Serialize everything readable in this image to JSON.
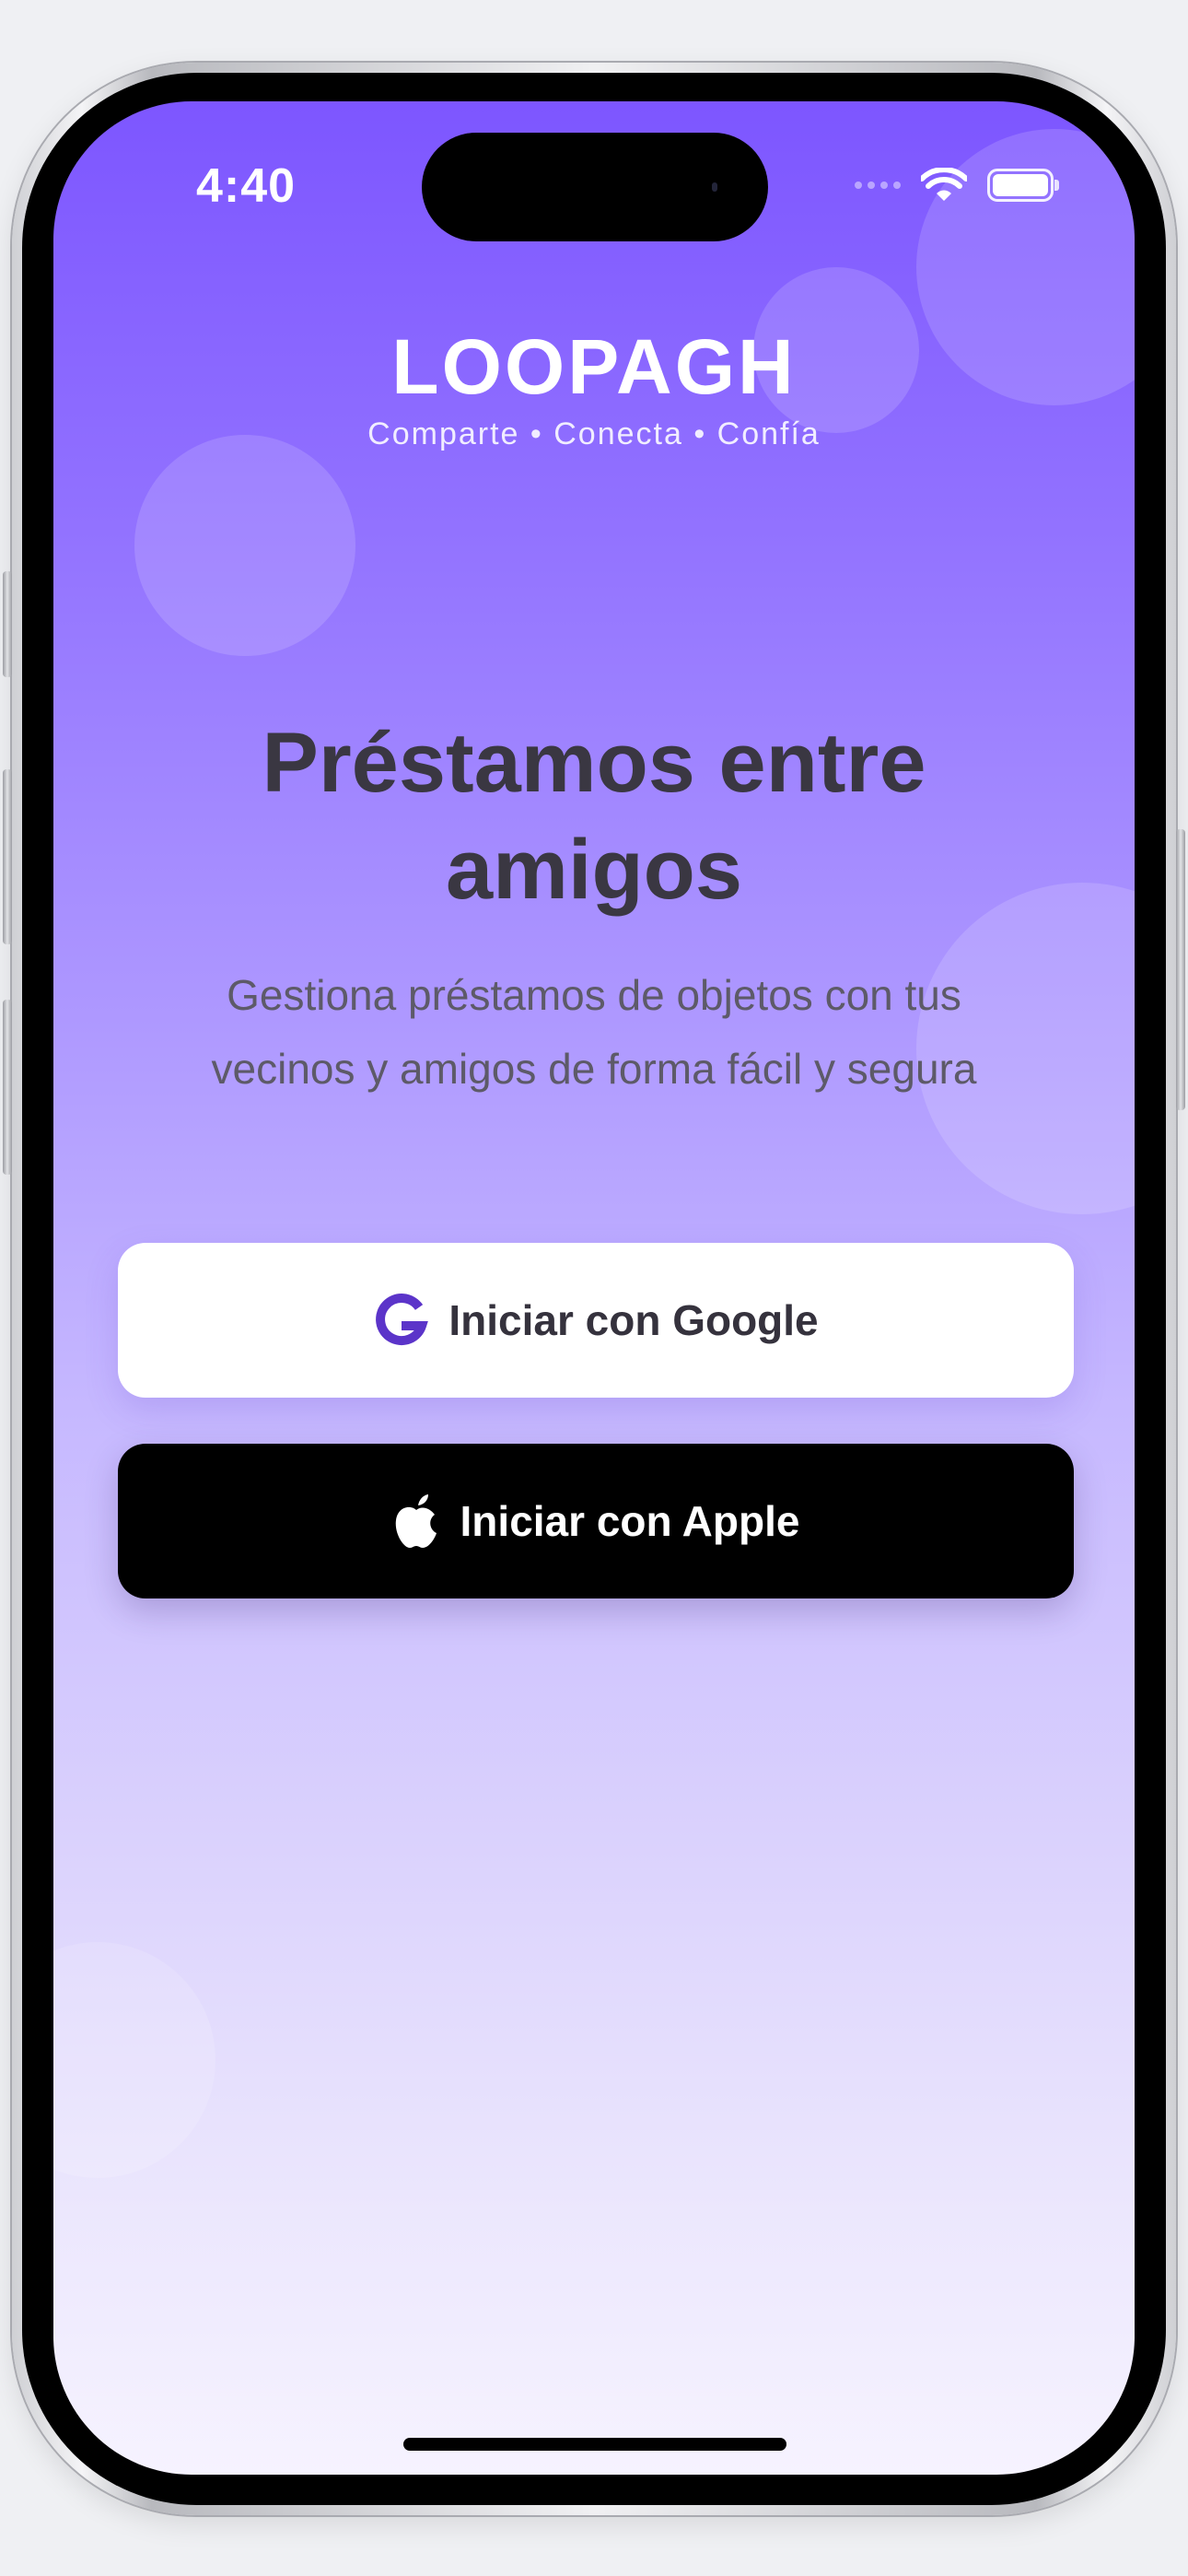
{
  "status_bar": {
    "time": "4:40",
    "battery_level": 1.0
  },
  "brand": {
    "name": "LOOPAGH",
    "tagline": "Comparte • Conecta • Confía"
  },
  "hero": {
    "title_line1": "Préstamos entre",
    "title_line2": "amigos",
    "subtitle_line1": "Gestiona préstamos de objetos con tus",
    "subtitle_line2": "vecinos y amigos de forma fácil y segura"
  },
  "auth": {
    "google": {
      "label": "Iniciar con Google",
      "icon": "google-g-icon"
    },
    "apple": {
      "label": "Iniciar con Apple",
      "icon": "apple-logo-icon"
    }
  },
  "colors": {
    "gradient_top": "#7d56ff",
    "gradient_bottom": "#f6f3ff",
    "google_icon": "#5b34c9",
    "apple_button_bg": "#000000"
  }
}
